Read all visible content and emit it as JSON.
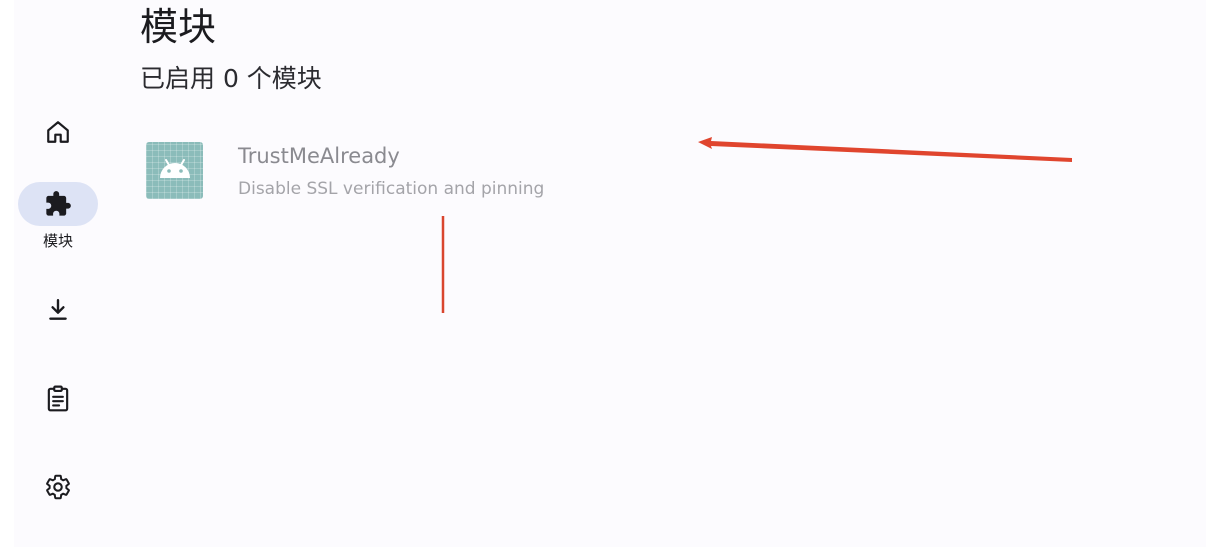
{
  "header": {
    "title": "模块",
    "subtitle": "已启用 0 个模块"
  },
  "nav": {
    "items": [
      {
        "name": "home",
        "icon": "home-icon",
        "label": "",
        "active": false
      },
      {
        "name": "modules",
        "icon": "puzzle-icon",
        "label": "模块",
        "active": true
      },
      {
        "name": "repository",
        "icon": "download-icon",
        "label": "",
        "active": false
      },
      {
        "name": "logs",
        "icon": "clipboard-icon",
        "label": "",
        "active": false
      },
      {
        "name": "settings",
        "icon": "gear-icon",
        "label": "",
        "active": false
      }
    ]
  },
  "modules": [
    {
      "name": "TrustMeAlready",
      "description": "Disable SSL verification and pinning",
      "icon": "android-icon",
      "enabled": false
    }
  ],
  "annotation": {
    "arrow_color": "#e0452e",
    "line_color": "#d9452e"
  },
  "colors": {
    "background": "#fcfbfe",
    "nav_indicator": "#dde3f5",
    "text_primary": "#1b1b1f",
    "module_icon_bg": "#8bbcba"
  }
}
